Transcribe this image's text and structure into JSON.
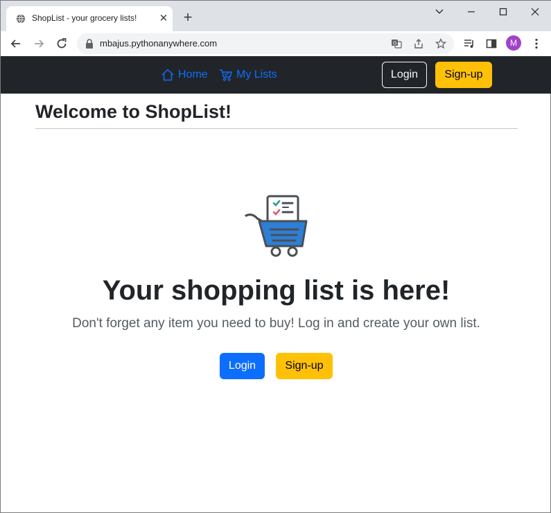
{
  "browser": {
    "tab_title": "ShopList - your grocery lists!",
    "tab_close": "✕",
    "new_tab": "+",
    "url": "mbajus.pythonanywhere.com",
    "profile_initial": "M",
    "icons": [
      "globe-icon",
      "back-icon",
      "forward-icon",
      "reload-icon",
      "lock-icon",
      "translate-icon",
      "share-icon",
      "star-icon",
      "media-icon",
      "sidepanel-icon",
      "menu-icon",
      "minimize-icon",
      "maximize-icon",
      "close-icon"
    ]
  },
  "navbar": {
    "home_label": "Home",
    "mylists_label": "My Lists",
    "login_label": "Login",
    "signup_label": "Sign-up",
    "link_color": "#0d6efd",
    "bg_color": "#212529"
  },
  "page": {
    "title": "Welcome to ShopList!",
    "hero_title": "Your shopping list is here!",
    "hero_lead": "Don't forget any item you need to buy! Log in and create your own list.",
    "login_label": "Login",
    "signup_label": "Sign-up",
    "primary_color": "#0d6efd",
    "warning_color": "#ffc107"
  }
}
